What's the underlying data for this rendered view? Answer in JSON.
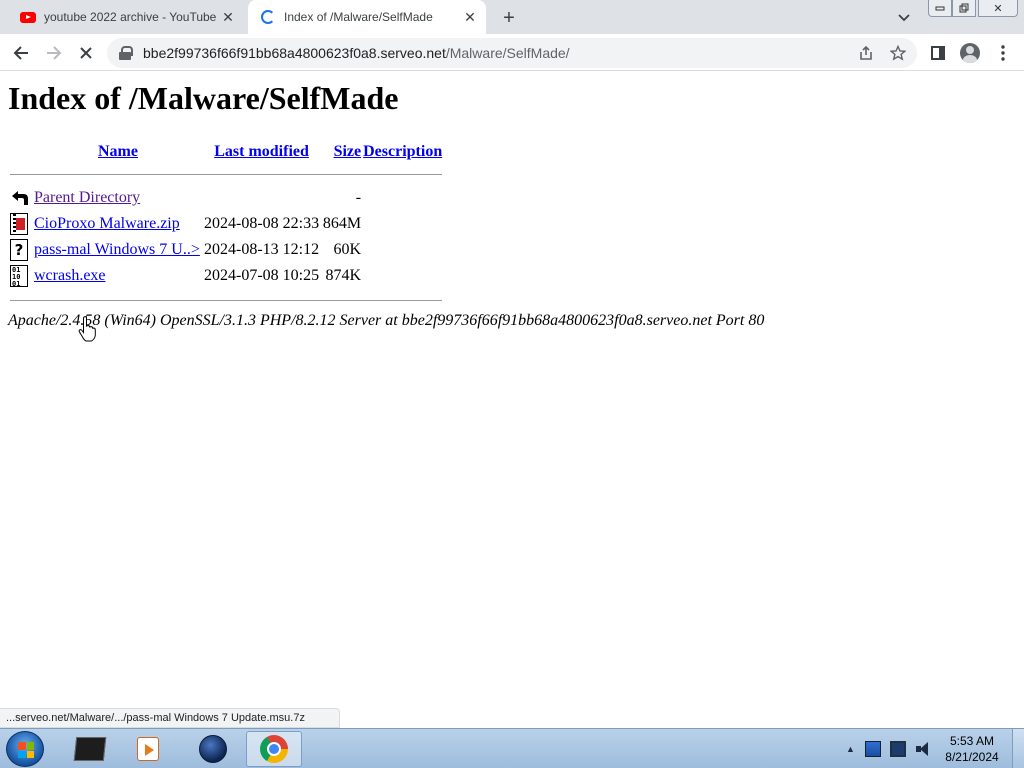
{
  "browser": {
    "tabs": [
      {
        "title": "youtube 2022 archive - YouTube",
        "favicon": "youtube-icon",
        "active": false
      },
      {
        "title": "Index of /Malware/SelfMade",
        "favicon": "loading-spinner-icon",
        "active": true
      }
    ],
    "new_tab_glyph": "+",
    "address": {
      "host": "bbe2f99736f66f91bb68a4800623f0a8.serveo.net",
      "path": "/Malware/SelfMade/"
    },
    "status_url": "...serveo.net/Malware/.../pass-mal Windows 7 Update.msu.7z"
  },
  "page": {
    "heading": "Index of /Malware/SelfMade",
    "columns": {
      "name": "Name",
      "modified": "Last modified",
      "size": "Size",
      "description": "Description"
    },
    "parent": {
      "name": "Parent Directory",
      "size": "-",
      "icon": "back-arrow-icon"
    },
    "files": [
      {
        "name": "CioProxo Malware.zip",
        "modified": "2024-08-08 22:33",
        "size": "864M",
        "icon": "compressed-file-icon"
      },
      {
        "name": "pass-mal Windows 7 U..>",
        "modified": "2024-08-13 12:12",
        "size": "60K",
        "icon": "unknown-file-icon"
      },
      {
        "name": "wcrash.exe",
        "modified": "2024-07-08 10:25",
        "size": "874K",
        "icon": "binary-file-icon"
      }
    ],
    "server_signature": "Apache/2.4.58 (Win64) OpenSSL/3.1.3 PHP/8.2.12 Server at bbe2f99736f66f91bb68a4800623f0a8.serveo.net Port 80"
  },
  "taskbar": {
    "apps": [
      "command-prompt-icon",
      "media-player-icon",
      "globe-icon",
      "chrome-icon"
    ],
    "clock": {
      "time": "5:53 AM",
      "date": "8/21/2024"
    }
  },
  "colors": {
    "link": "#0000ee",
    "visited_link": "#551a8b",
    "tabstrip": "#dee1e6",
    "omnibox": "#f1f3f4",
    "taskbar": "#b9d1ea"
  }
}
